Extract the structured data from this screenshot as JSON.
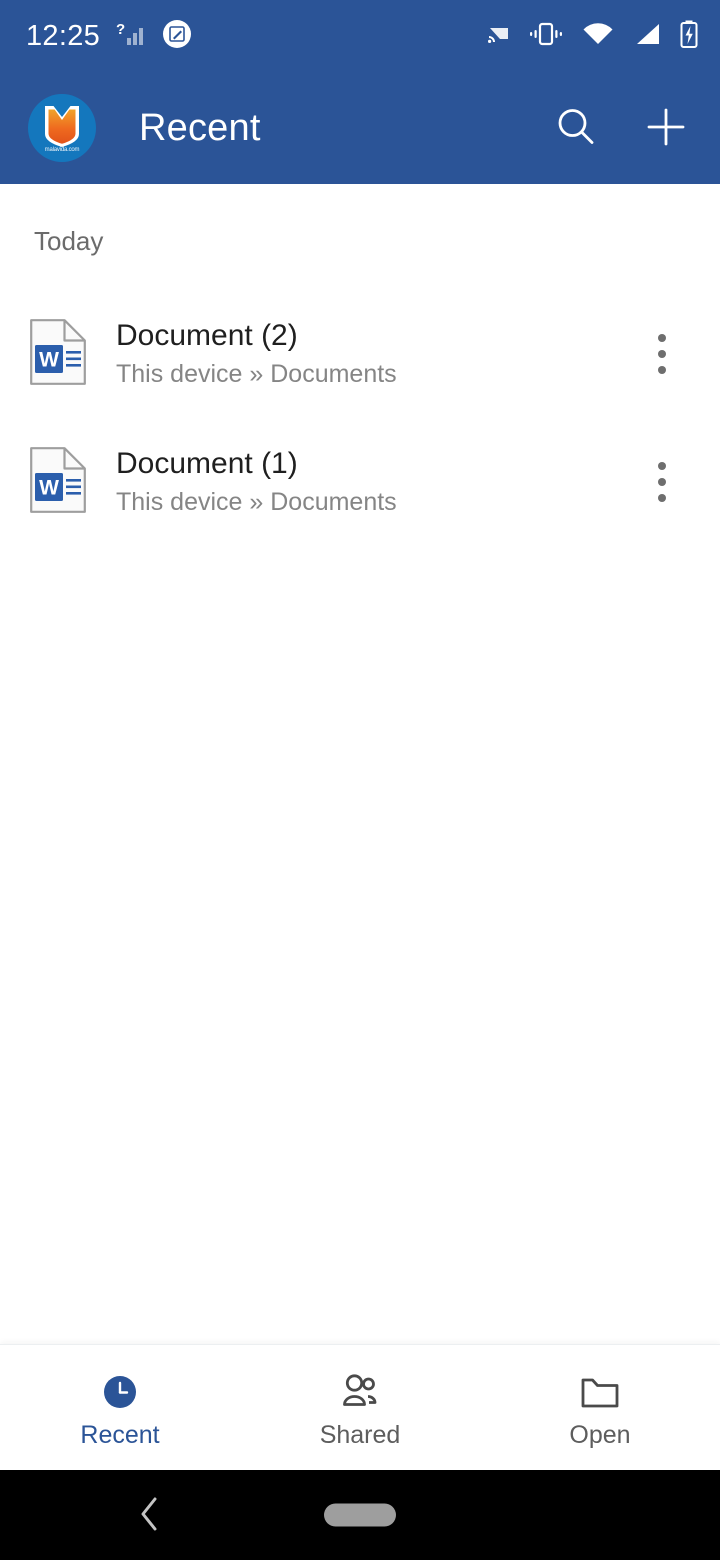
{
  "status_bar": {
    "time": "12:25",
    "icons_left": [
      "signal-unknown-icon",
      "screenshot-edit-icon"
    ],
    "icons_right": [
      "cast-icon",
      "vibrate-icon",
      "wifi-icon",
      "cellular-signal-icon",
      "battery-charging-icon"
    ],
    "background_color": "#2B5497"
  },
  "app_bar": {
    "title": "Recent",
    "logo_watermark_text": "malavida.com",
    "logo_name": "malavida-logo",
    "background_color": "#2B5497",
    "search_label": "Search",
    "new_label": "New"
  },
  "content": {
    "section_label": "Today",
    "files": [
      {
        "name": "Document (2)",
        "location": "This device » Documents",
        "file_type": "word-document",
        "more_label": "More options"
      },
      {
        "name": "Document (1)",
        "location": "This device » Documents",
        "file_type": "word-document",
        "more_label": "More options"
      }
    ]
  },
  "bottom_nav": {
    "active_color": "#2B5497",
    "inactive_color": "#5d5d5d",
    "items": [
      {
        "label": "Recent",
        "icon": "clock-icon",
        "active": true
      },
      {
        "label": "Shared",
        "icon": "people-icon",
        "active": false
      },
      {
        "label": "Open",
        "icon": "folder-icon",
        "active": false
      }
    ]
  },
  "android_nav": {
    "back_label": "Back",
    "home_pill_label": "Home"
  }
}
